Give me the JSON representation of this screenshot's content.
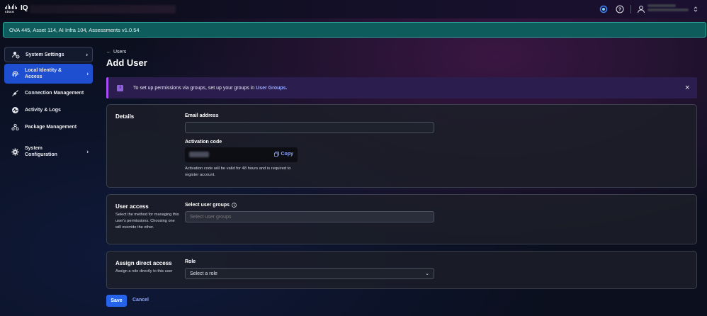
{
  "topbar": {
    "brand_word": "cisco",
    "product": "IQ",
    "icons": [
      "status-ring-icon",
      "help-icon",
      "user-icon",
      "expand-icon"
    ]
  },
  "banner": {
    "text": "OVA 445, Asset 114, AI Infra 104, Assessments v1.0.54"
  },
  "sidebar": {
    "items": [
      {
        "label": "System Settings",
        "icon": "user-gear-icon"
      },
      {
        "label": "Local Identity & Access",
        "icon": "fingerprint-icon"
      },
      {
        "label": "Connection Management",
        "icon": "plug-icon"
      },
      {
        "label": "Activity & Logs",
        "icon": "activity-icon"
      },
      {
        "label": "Package Management",
        "icon": "packages-icon"
      },
      {
        "label": "System Configuration",
        "icon": "gear-icon"
      }
    ]
  },
  "main": {
    "back_label": "Users",
    "title": "Add User",
    "info": {
      "text": "To set up permissions via groups, set up your groups in ",
      "link": "User Groups."
    },
    "details": {
      "title": "Details",
      "email_label": "Email address",
      "email_value": "",
      "activation_label": "Activation code",
      "copy_label": "Copy",
      "activation_hint": "Activation code will be valid for 48 hours and is required to register account."
    },
    "user_access": {
      "title": "User access",
      "desc": "Select the method for managing this user's permissions. Choosing one will override the other.",
      "groups_label": "Select user groups",
      "groups_placeholder": "Select user groups"
    },
    "direct_access": {
      "title": "Assign direct access",
      "desc": "Assign a role directly to this user",
      "role_label": "Role",
      "role_value": "Select a role"
    },
    "save_label": "Save",
    "cancel_label": "Cancel"
  },
  "colors": {
    "accent": "#2563eb",
    "banner_bg": "#0f5c5c",
    "info_bg": "#2b1d4e",
    "info_border": "#a64df5",
    "link": "#8fa6ff"
  }
}
